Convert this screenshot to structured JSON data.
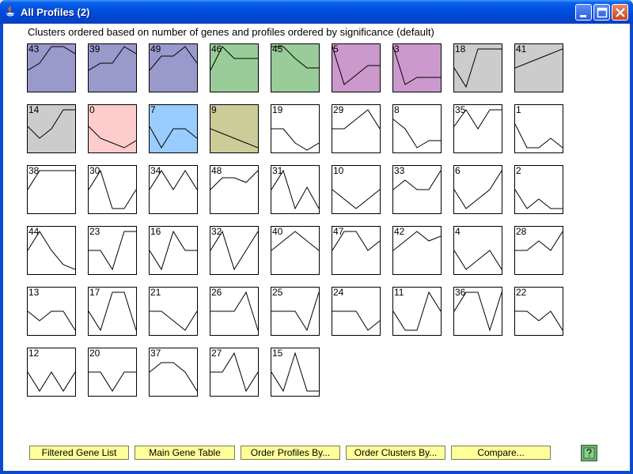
{
  "window": {
    "title": "All Profiles (2)"
  },
  "header": {
    "description": "Clusters ordered based on number of genes and profiles ordered by significance (default)"
  },
  "colors": {
    "blue": "#9999cc",
    "green": "#99cc99",
    "purple": "#cc99cc",
    "gray": "#cccccc",
    "pink": "#ffcccc",
    "lightblue": "#99ccff",
    "olive": "#cccc99",
    "white": "#ffffff"
  },
  "profiles": [
    {
      "id": "43",
      "color": "blue",
      "points": [
        0.55,
        0.4,
        0.05,
        0.05,
        0.2
      ]
    },
    {
      "id": "39",
      "color": "blue",
      "points": [
        0.55,
        0.4,
        0.4,
        0.05,
        0.2
      ]
    },
    {
      "id": "49",
      "color": "blue",
      "points": [
        0.55,
        0.25,
        0.25,
        0.05,
        0.4
      ]
    },
    {
      "id": "46",
      "color": "green",
      "points": [
        0.55,
        0.05,
        0.3,
        0.3,
        0.3
      ]
    },
    {
      "id": "45",
      "color": "green",
      "points": [
        0.05,
        0.05,
        0.3,
        0.5,
        0.5
      ]
    },
    {
      "id": "5",
      "color": "purple",
      "points": [
        0.05,
        0.85,
        0.65,
        0.45,
        0.45
      ]
    },
    {
      "id": "3",
      "color": "purple",
      "points": [
        0.05,
        0.85,
        0.7,
        0.7,
        0.7
      ]
    },
    {
      "id": "18",
      "color": "gray",
      "points": [
        0.5,
        0.9,
        0.1,
        0.1,
        0.1
      ]
    },
    {
      "id": "41",
      "color": "gray",
      "points": [
        0.5,
        0.4,
        0.3,
        0.2,
        0.1
      ]
    },
    {
      "id": "14",
      "color": "gray",
      "points": [
        0.45,
        0.7,
        0.5,
        0.1,
        0.1
      ]
    },
    {
      "id": "0",
      "color": "pink",
      "points": [
        0.45,
        0.7,
        0.8,
        0.9,
        0.75
      ]
    },
    {
      "id": "7",
      "color": "lightblue",
      "points": [
        0.45,
        0.9,
        0.5,
        0.5,
        0.7
      ]
    },
    {
      "id": "9",
      "color": "olive",
      "points": [
        0.5,
        0.6,
        0.7,
        0.8,
        0.9
      ]
    },
    {
      "id": "19",
      "color": "white",
      "points": [
        0.5,
        0.5,
        0.8,
        0.95,
        0.8
      ]
    },
    {
      "id": "29",
      "color": "white",
      "points": [
        0.5,
        0.5,
        0.3,
        0.1,
        0.5
      ]
    },
    {
      "id": "8",
      "color": "white",
      "points": [
        0.3,
        0.5,
        0.9,
        0.75,
        0.75
      ]
    },
    {
      "id": "35",
      "color": "white",
      "points": [
        0.45,
        0.1,
        0.5,
        0.1,
        0.1
      ]
    },
    {
      "id": "1",
      "color": "white",
      "points": [
        0.4,
        0.9,
        0.9,
        0.7,
        0.9
      ]
    },
    {
      "id": "38",
      "color": "white",
      "points": [
        0.5,
        0.1,
        0.1,
        0.1,
        0.1
      ]
    },
    {
      "id": "30",
      "color": "white",
      "points": [
        0.5,
        0.1,
        0.9,
        0.9,
        0.5
      ]
    },
    {
      "id": "34",
      "color": "white",
      "points": [
        0.5,
        0.1,
        0.5,
        0.1,
        0.5
      ]
    },
    {
      "id": "48",
      "color": "white",
      "points": [
        0.5,
        0.25,
        0.25,
        0.35,
        0.1
      ]
    },
    {
      "id": "31",
      "color": "white",
      "points": [
        0.5,
        0.1,
        0.9,
        0.45,
        0.9
      ]
    },
    {
      "id": "10",
      "color": "white",
      "points": [
        0.5,
        0.7,
        0.9,
        0.7,
        0.5
      ]
    },
    {
      "id": "33",
      "color": "white",
      "points": [
        0.5,
        0.3,
        0.5,
        0.5,
        0.1
      ]
    },
    {
      "id": "6",
      "color": "white",
      "points": [
        0.5,
        0.9,
        0.7,
        0.5,
        0.1
      ]
    },
    {
      "id": "2",
      "color": "white",
      "points": [
        0.5,
        0.9,
        0.7,
        0.9,
        0.9
      ]
    },
    {
      "id": "44",
      "color": "white",
      "points": [
        0.5,
        0.1,
        0.5,
        0.8,
        0.9
      ]
    },
    {
      "id": "23",
      "color": "white",
      "points": [
        0.5,
        0.5,
        0.9,
        0.1,
        0.1
      ]
    },
    {
      "id": "16",
      "color": "white",
      "points": [
        0.5,
        0.9,
        0.1,
        0.5,
        0.5
      ]
    },
    {
      "id": "32",
      "color": "white",
      "points": [
        0.5,
        0.1,
        0.9,
        0.5,
        0.1
      ]
    },
    {
      "id": "40",
      "color": "white",
      "points": [
        0.5,
        0.3,
        0.1,
        0.3,
        0.5
      ]
    },
    {
      "id": "47",
      "color": "white",
      "points": [
        0.5,
        0.1,
        0.1,
        0.5,
        0.3
      ]
    },
    {
      "id": "42",
      "color": "white",
      "points": [
        0.5,
        0.3,
        0.1,
        0.3,
        0.2
      ]
    },
    {
      "id": "4",
      "color": "white",
      "points": [
        0.5,
        0.9,
        0.7,
        0.5,
        0.9
      ]
    },
    {
      "id": "28",
      "color": "white",
      "points": [
        0.5,
        0.5,
        0.3,
        0.5,
        0.1
      ]
    },
    {
      "id": "13",
      "color": "white",
      "points": [
        0.5,
        0.7,
        0.5,
        0.5,
        0.9
      ]
    },
    {
      "id": "17",
      "color": "white",
      "points": [
        0.5,
        0.9,
        0.1,
        0.1,
        0.9
      ]
    },
    {
      "id": "21",
      "color": "white",
      "points": [
        0.5,
        0.5,
        0.7,
        0.9,
        0.5
      ]
    },
    {
      "id": "26",
      "color": "white",
      "points": [
        0.5,
        0.5,
        0.5,
        0.1,
        0.9
      ]
    },
    {
      "id": "25",
      "color": "white",
      "points": [
        0.5,
        0.5,
        0.5,
        0.9,
        0.1
      ]
    },
    {
      "id": "24",
      "color": "white",
      "points": [
        0.5,
        0.5,
        0.5,
        0.9,
        0.7
      ]
    },
    {
      "id": "11",
      "color": "white",
      "points": [
        0.5,
        0.9,
        0.9,
        0.1,
        0.5
      ]
    },
    {
      "id": "36",
      "color": "white",
      "points": [
        0.5,
        0.1,
        0.1,
        0.9,
        0.1
      ]
    },
    {
      "id": "22",
      "color": "white",
      "points": [
        0.5,
        0.5,
        0.7,
        0.5,
        0.9
      ]
    },
    {
      "id": "12",
      "color": "white",
      "points": [
        0.5,
        0.9,
        0.5,
        0.9,
        0.5
      ]
    },
    {
      "id": "20",
      "color": "white",
      "points": [
        0.5,
        0.5,
        0.9,
        0.5,
        0.5
      ]
    },
    {
      "id": "37",
      "color": "white",
      "points": [
        0.5,
        0.3,
        0.3,
        0.5,
        0.9
      ]
    },
    {
      "id": "27",
      "color": "white",
      "points": [
        0.5,
        0.5,
        0.1,
        0.9,
        0.5
      ]
    },
    {
      "id": "15",
      "color": "white",
      "points": [
        0.5,
        0.9,
        0.1,
        0.9,
        0.9
      ]
    }
  ],
  "buttons": {
    "filtered_gene_list": "Filtered Gene List",
    "main_gene_table": "Main Gene Table",
    "order_profiles": "Order Profiles By...",
    "order_clusters": "Order Clusters By...",
    "compare": "Compare..."
  },
  "help": {
    "icon": "question-help-icon"
  }
}
